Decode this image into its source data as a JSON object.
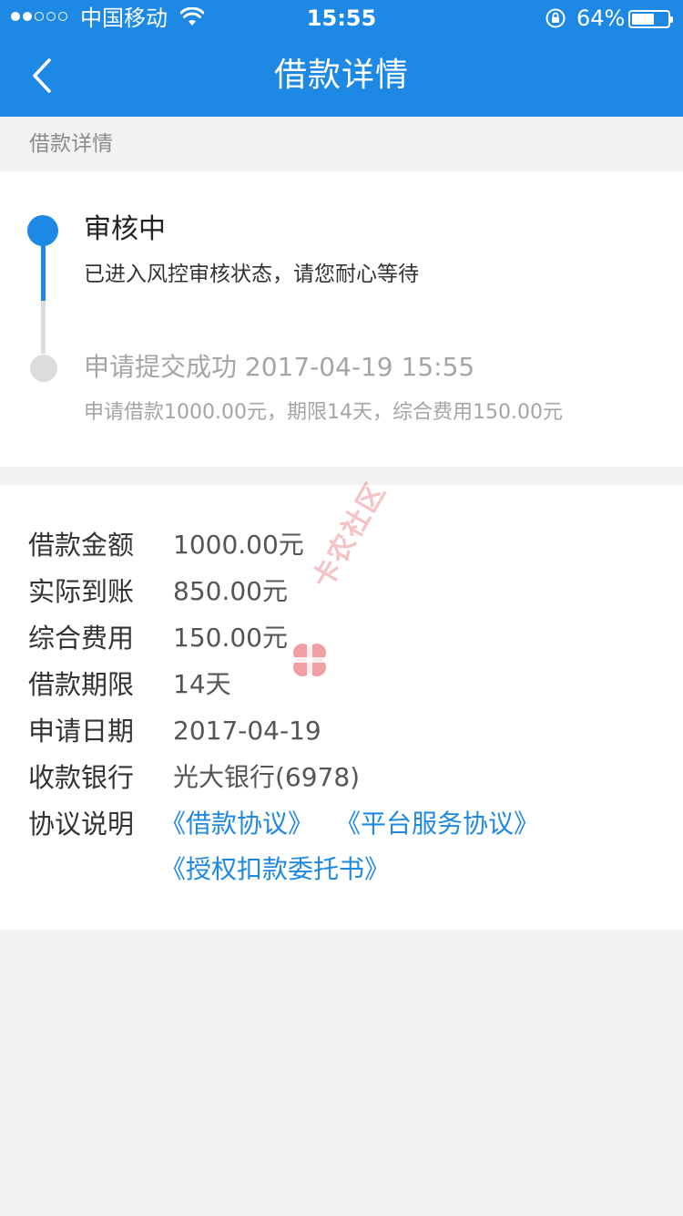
{
  "status_bar": {
    "carrier": "中国移动",
    "time": "15:55",
    "battery_percent": "64%",
    "battery_level": 0.64,
    "signal_strength": 2,
    "signal_total": 5
  },
  "nav": {
    "title": "借款详情",
    "back_icon": "chevron-left-icon"
  },
  "section_header": "借款详情",
  "progress": {
    "current": {
      "title": "审核中",
      "desc": "已进入风控审核状态，请您耐心等待"
    },
    "done": {
      "title": "申请提交成功 2017-04-19 15:55",
      "desc": "申请借款1000.00元，期限14天，综合费用150.00元"
    }
  },
  "details": [
    {
      "label": "借款金额",
      "value": "1000.00元"
    },
    {
      "label": "实际到账",
      "value": "850.00元"
    },
    {
      "label": "综合费用",
      "value": "150.00元"
    },
    {
      "label": "借款期限",
      "value": "14天"
    },
    {
      "label": "申请日期",
      "value": "2017-04-19"
    },
    {
      "label": "收款银行",
      "value": "光大银行(6978)"
    }
  ],
  "agreement": {
    "label": "协议说明",
    "links": [
      "《借款协议》",
      "《平台服务协议》",
      "《授权扣款委托书》"
    ]
  },
  "watermark": {
    "text": "卡农社区"
  },
  "colors": {
    "primary": "#1e88e5",
    "page_bg": "#f2f2f2",
    "inactive": "#dcdcdc",
    "watermark": "#e6505a"
  }
}
